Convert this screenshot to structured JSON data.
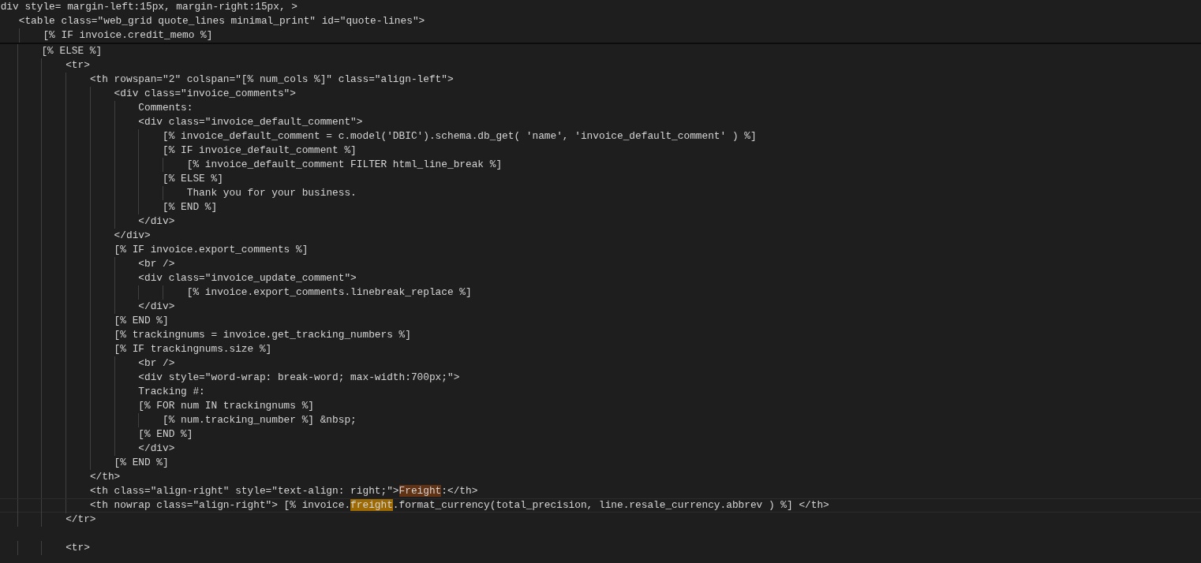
{
  "sticky_lines": [
    {
      "text": " div style= margin-left:15px, margin-right:15px, >"
    },
    {
      "text": "    <table class=\"web_grid quote_lines minimal_print\" id=\"quote-lines\">"
    },
    {
      "text": "        [% IF invoice.credit_memo %]"
    }
  ],
  "lines": [
    {
      "current": false,
      "segments": [
        {
          "text": "        [% ELSE %]"
        }
      ]
    },
    {
      "current": false,
      "segments": [
        {
          "text": "            <tr>"
        }
      ]
    },
    {
      "current": false,
      "segments": [
        {
          "text": "                <th rowspan=\"2\" colspan=\"[% num_cols %]\" class=\"align-left\">"
        }
      ]
    },
    {
      "current": false,
      "segments": [
        {
          "text": "                    <div class=\"invoice_comments\">"
        }
      ]
    },
    {
      "current": false,
      "segments": [
        {
          "text": "                        Comments:"
        }
      ]
    },
    {
      "current": false,
      "segments": [
        {
          "text": "                        <div class=\"invoice_default_comment\">"
        }
      ]
    },
    {
      "current": false,
      "segments": [
        {
          "text": "                            [% invoice_default_comment = c.model('DBIC').schema.db_get( 'name', 'invoice_default_comment' ) %]"
        }
      ]
    },
    {
      "current": false,
      "segments": [
        {
          "text": "                            [% IF invoice_default_comment %]"
        }
      ]
    },
    {
      "current": false,
      "segments": [
        {
          "text": "                                [% invoice_default_comment FILTER html_line_break %]"
        }
      ]
    },
    {
      "current": false,
      "segments": [
        {
          "text": "                            [% ELSE %]"
        }
      ]
    },
    {
      "current": false,
      "segments": [
        {
          "text": "                                Thank you for your business."
        }
      ]
    },
    {
      "current": false,
      "segments": [
        {
          "text": "                            [% END %]"
        }
      ]
    },
    {
      "current": false,
      "segments": [
        {
          "text": "                        </div>"
        }
      ]
    },
    {
      "current": false,
      "segments": [
        {
          "text": "                    </div>"
        }
      ]
    },
    {
      "current": false,
      "segments": [
        {
          "text": "                    [% IF invoice.export_comments %]"
        }
      ]
    },
    {
      "current": false,
      "segments": [
        {
          "text": "                        <br />"
        }
      ]
    },
    {
      "current": false,
      "segments": [
        {
          "text": "                        <div class=\"invoice_update_comment\">"
        }
      ]
    },
    {
      "current": false,
      "segments": [
        {
          "text": "                                [% invoice.export_comments.linebreak_replace %]"
        }
      ]
    },
    {
      "current": false,
      "segments": [
        {
          "text": "                        </div>"
        }
      ]
    },
    {
      "current": false,
      "segments": [
        {
          "text": "                    [% END %]"
        }
      ]
    },
    {
      "current": false,
      "segments": [
        {
          "text": "                    [% trackingnums = invoice.get_tracking_numbers %]"
        }
      ]
    },
    {
      "current": false,
      "segments": [
        {
          "text": "                    [% IF trackingnums.size %]"
        }
      ]
    },
    {
      "current": false,
      "segments": [
        {
          "text": "                        <br />"
        }
      ]
    },
    {
      "current": false,
      "segments": [
        {
          "text": "                        <div style=\"word-wrap: break-word; max-width:700px;\">"
        }
      ]
    },
    {
      "current": false,
      "segments": [
        {
          "text": "                        Tracking #:"
        }
      ]
    },
    {
      "current": false,
      "segments": [
        {
          "text": "                        [% FOR num IN trackingnums %]"
        }
      ]
    },
    {
      "current": false,
      "segments": [
        {
          "text": "                            [% num.tracking_number %] &nbsp;"
        }
      ]
    },
    {
      "current": false,
      "segments": [
        {
          "text": "                        [% END %]"
        }
      ]
    },
    {
      "current": false,
      "segments": [
        {
          "text": "                        </div>"
        }
      ]
    },
    {
      "current": false,
      "segments": [
        {
          "text": "                    [% END %]"
        }
      ]
    },
    {
      "current": false,
      "segments": [
        {
          "text": "                </th>"
        }
      ]
    },
    {
      "current": false,
      "segments": [
        {
          "text": "                <th class=\"align-right\" style=\"text-align: right;\">"
        },
        {
          "text": "Freight",
          "match": true,
          "active": false
        },
        {
          "text": ":</th>"
        }
      ]
    },
    {
      "current": true,
      "segments": [
        {
          "text": "                <th nowrap class=\"align-right\"> [% invoice."
        },
        {
          "text": "freight",
          "match": true,
          "active": true
        },
        {
          "text": ".format_currency(total_precision, line.resale_currency.abbrev ) %] </th>"
        }
      ]
    },
    {
      "current": false,
      "segments": [
        {
          "text": "            </tr>"
        }
      ]
    },
    {
      "current": false
    },
    {
      "current": false,
      "segments": [
        {
          "text": "            <tr>"
        }
      ]
    }
  ]
}
